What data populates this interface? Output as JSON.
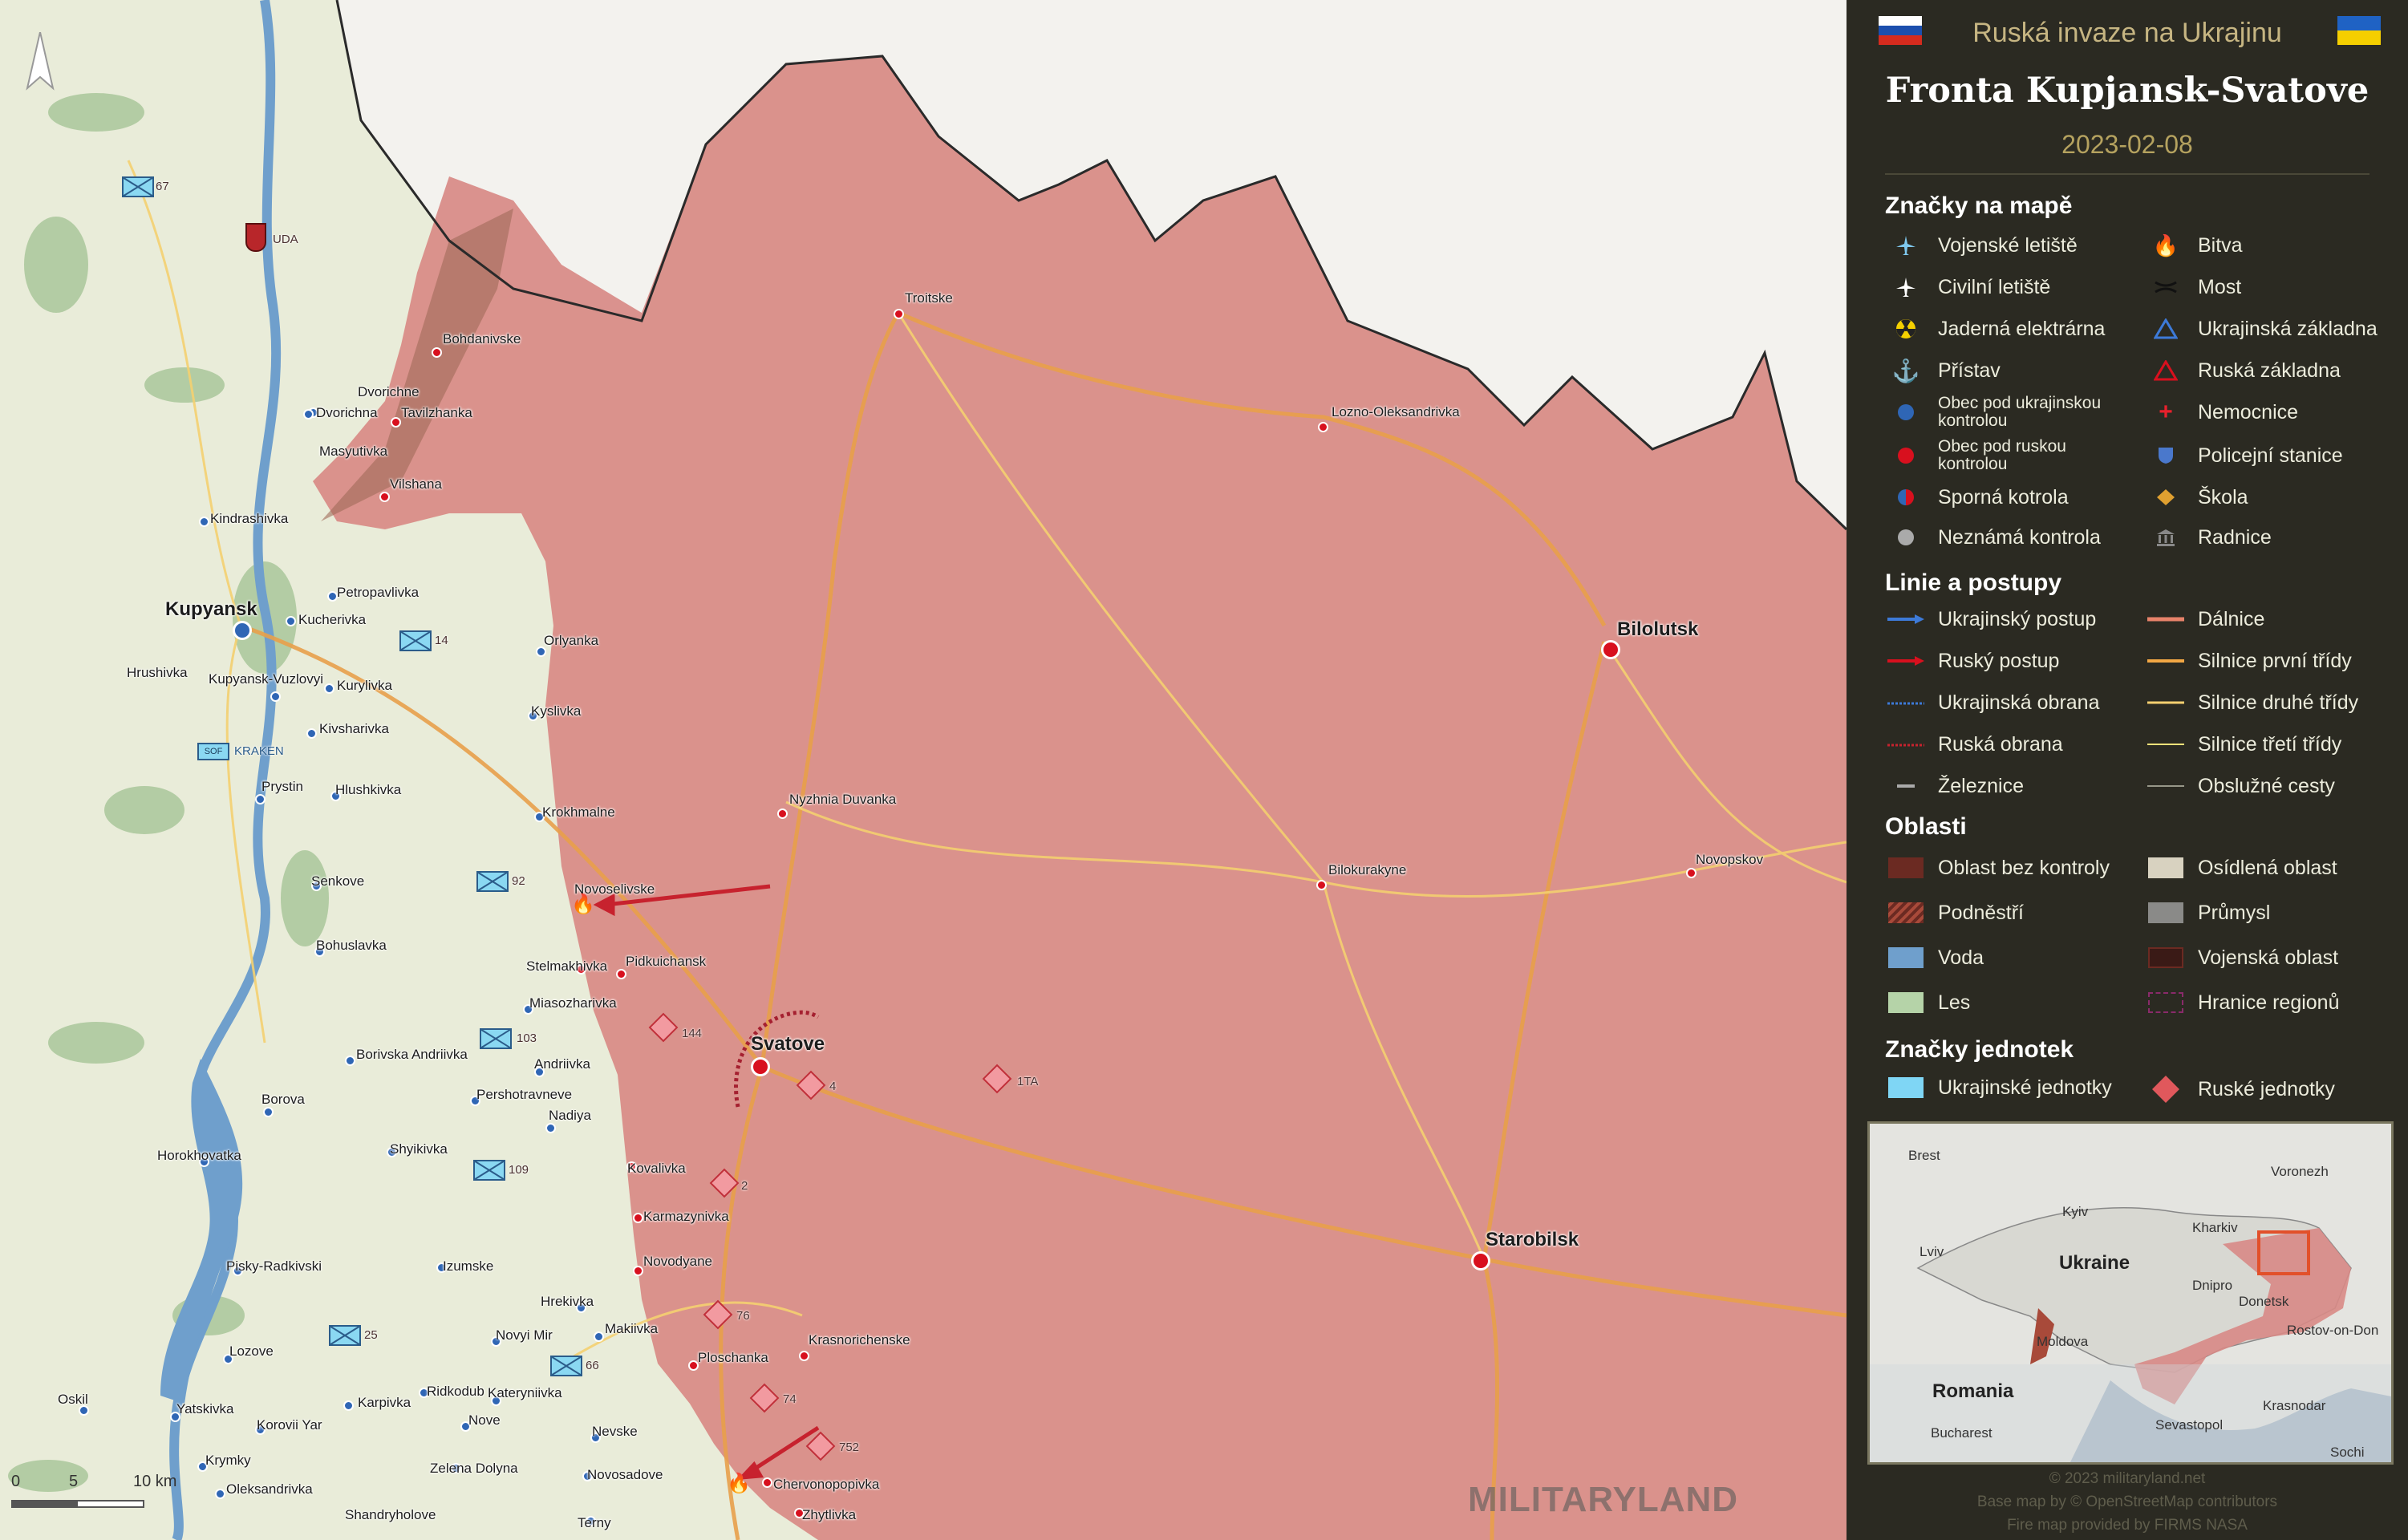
{
  "header": {
    "subtitle": "Ruská invaze na Ukrajinu",
    "title": "Fronta Kupjansk-Svatove",
    "date": "2023-02-08"
  },
  "legend": {
    "symbols_title": "Značky na mapě",
    "symbols_left": [
      {
        "icon": "military-airport-icon",
        "label": "Vojenské letiště"
      },
      {
        "icon": "civil-airport-icon",
        "label": "Civilní letiště"
      },
      {
        "icon": "nuclear-plant-icon",
        "label": "Jaderná elektrárna"
      },
      {
        "icon": "port-anchor-icon",
        "label": "Přístav"
      },
      {
        "icon": "ukrainian-control-dot-icon",
        "label": "Obec pod ukrajinskou kontrolou"
      },
      {
        "icon": "russian-control-dot-icon",
        "label": "Obec pod ruskou kontrolou"
      },
      {
        "icon": "contested-dot-icon",
        "label": "Sporná kotrola"
      },
      {
        "icon": "unknown-control-dot-icon",
        "label": "Neznámá kontrola"
      }
    ],
    "symbols_right": [
      {
        "icon": "battle-fire-icon",
        "label": "Bitva"
      },
      {
        "icon": "bridge-icon",
        "label": "Most"
      },
      {
        "icon": "ukrainian-base-icon",
        "label": "Ukrajinská základna"
      },
      {
        "icon": "russian-base-icon",
        "label": "Ruská základna"
      },
      {
        "icon": "hospital-cross-icon",
        "label": "Nemocnice"
      },
      {
        "icon": "police-station-icon",
        "label": "Policejní stanice"
      },
      {
        "icon": "school-icon",
        "label": "Škola"
      },
      {
        "icon": "town-hall-icon",
        "label": "Radnice"
      }
    ],
    "lines_title": "Linie a postupy",
    "lines_left": [
      {
        "icon": "ukrainian-advance-arrow-icon",
        "label": "Ukrajinský postup"
      },
      {
        "icon": "russian-advance-arrow-icon",
        "label": "Ruský postup"
      },
      {
        "icon": "ukrainian-defense-line-icon",
        "label": "Ukrajinská obrana"
      },
      {
        "icon": "russian-defense-line-icon",
        "label": "Ruská obrana"
      },
      {
        "icon": "railway-icon",
        "label": "Železnice"
      }
    ],
    "lines_right": [
      {
        "icon": "motorway-line-icon",
        "label": "Dálnice"
      },
      {
        "icon": "primary-road-line-icon",
        "label": "Silnice první třídy"
      },
      {
        "icon": "secondary-road-line-icon",
        "label": "Silnice druhé třídy"
      },
      {
        "icon": "tertiary-road-line-icon",
        "label": "Silnice třetí třídy"
      },
      {
        "icon": "service-road-line-icon",
        "label": "Obslužné cesty"
      }
    ],
    "areas_title": "Oblasti",
    "areas_left": [
      {
        "icon": "uncontrolled-area-swatch",
        "label": "Oblast bez kontroly"
      },
      {
        "icon": "transnistria-hatch-swatch",
        "label": "Podněstří"
      },
      {
        "icon": "water-swatch",
        "label": "Voda"
      },
      {
        "icon": "forest-swatch",
        "label": "Les"
      }
    ],
    "areas_right": [
      {
        "icon": "settlement-swatch",
        "label": "Osídlená oblast"
      },
      {
        "icon": "industry-swatch",
        "label": "Průmysl"
      },
      {
        "icon": "military-area-swatch",
        "label": "Vojenská oblast"
      },
      {
        "icon": "region-border-swatch",
        "label": "Hranice regionů"
      }
    ],
    "units_title": "Značky jednotek",
    "units": [
      {
        "icon": "ukrainian-unit-icon",
        "label": "Ukrajinské jednotky"
      },
      {
        "icon": "russian-unit-icon",
        "label": "Ruské jednotky"
      }
    ]
  },
  "inset": {
    "labels": [
      "Brest",
      "Voronezh",
      "Kyiv",
      "Kharkiv",
      "Lviv",
      "Ukraine",
      "Dnipro",
      "Donetsk",
      "Rostov-on-Don",
      "Moldova",
      "Romania",
      "Krasnodar",
      "Bucharest",
      "Sevastopol",
      "Sochi"
    ]
  },
  "credits": {
    "line1": "© 2023 militaryland.net",
    "line2": "Base map by © OpenStreetMap contributors",
    "line3": "Fire map provided by FIRMS NASA"
  },
  "map": {
    "towns_big": [
      "Kupyansk",
      "Svatove",
      "Bilolutsk",
      "Starobilsk"
    ],
    "towns_ru": [
      "Bohdanivske",
      "Tavilzhanka",
      "Vilshana",
      "Troitske",
      "Lozno-Oleksandrivka",
      "Nyzhnia Duvanka",
      "Bilokurakyne",
      "Novopskov",
      "Pidkuichansk",
      "Krasnorichenske",
      "Chervonopopivka",
      "Zhytlivka",
      "Kovalivka",
      "Karmazynivka",
      "Novodyane",
      "Ploschanka",
      "Stelmakhivka"
    ],
    "towns_ua": [
      "Dvorichne",
      "Dvorichna",
      "Masyutivka",
      "Kindrashivka",
      "Petropavlivka",
      "Kucherivka",
      "Hrushivka",
      "Kupyansk-Vuzlovyi",
      "Kurylivka",
      "Kivsharivka",
      "Prystin",
      "Hlushkivka",
      "Senkove",
      "Bohuslavka",
      "Borivska Andriivka",
      "Borova",
      "Horokhovatka",
      "Shyikivka",
      "Pisky-Radkivski",
      "Lozove",
      "Oskil",
      "Yatskivka",
      "Korovii Yar",
      "Krymky",
      "Oleksandrivka",
      "Shandryholove",
      "Karpivka",
      "Ridkodub",
      "Zelena Dolyna",
      "Novosadove",
      "Terny",
      "Nevske",
      "Nove",
      "Novyi Mir",
      "Kateryniivka",
      "Makiivka",
      "Hrekivka",
      "Izumske",
      "Nadiya",
      "Pershotravneve",
      "Andriivka",
      "Miasozharivka",
      "Krokhmalne",
      "Kyslivka",
      "Orlyanka",
      "Novoselivske"
    ],
    "units": [
      "67",
      "UDA",
      "14",
      "SOF",
      "KRAKEN",
      "92",
      "103",
      "109",
      "25",
      "66",
      "144",
      "4",
      "1TA",
      "2",
      "76",
      "74",
      "752"
    ],
    "scale": {
      "zero": "0",
      "five": "5",
      "ten": "10 km"
    },
    "watermark": "MILITARYLAND"
  },
  "colors": {
    "occupied": "#d88a86",
    "panel": "#2b2a22",
    "accent_gold": "#c6b582",
    "water": "#6f9fcc",
    "forest": "#9bbf8a"
  }
}
